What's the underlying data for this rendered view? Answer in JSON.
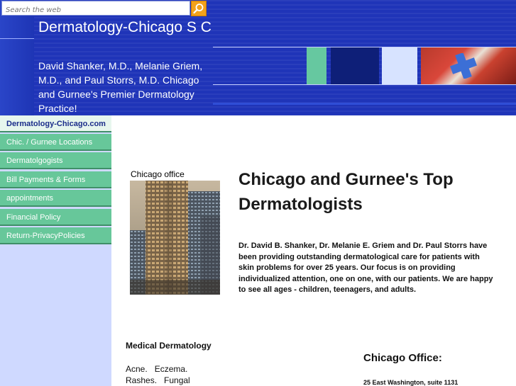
{
  "search": {
    "placeholder": "Search the web"
  },
  "header": {
    "title": "Dermatology-Chicago S C",
    "subtitle": "David Shanker, M.D., Melanie Griem, M.D., and Paul Storrs, M.D. Chicago and Gurnee's Premier Dermatology Practice!"
  },
  "nav": {
    "items": [
      {
        "label": "Dermatology-Chicago.com"
      },
      {
        "label": "Chic. / Gurnee Locations"
      },
      {
        "label": "Dermatolgogists"
      },
      {
        "label": "Bill Payments & Forms"
      },
      {
        "label": "appointments"
      },
      {
        "label": "Financial Policy"
      },
      {
        "label": "Return-PrivacyPolicies"
      }
    ]
  },
  "main": {
    "photo_caption": "Chicago office",
    "heading": "Chicago and Gurnee's Top Dermatologists",
    "paragraph": "Dr. David B. Shanker, Dr. Melanie E. Griem and Dr. Paul Storrs have been providing outstanding dermatological care for patients with skin problems for over 25 years.  Our focus is on providing individualized attention, one on one, with our patients.  We are happy to see all ages - children, teenagers, and adults.",
    "medical_heading": "Medical Dermatology",
    "medical_line1": "Acne.   Eczema.",
    "medical_line2": "Rashes.   Fungal",
    "office_heading": "Chicago Office:",
    "office_address": "25 East Washington, suite 1131"
  },
  "colors": {
    "header_blue": "#1f34b8",
    "nav_green": "#67c79a",
    "sidebar_bg": "#cfd9ff",
    "search_button": "#f3a21b"
  },
  "icons": [
    "search-icon"
  ]
}
